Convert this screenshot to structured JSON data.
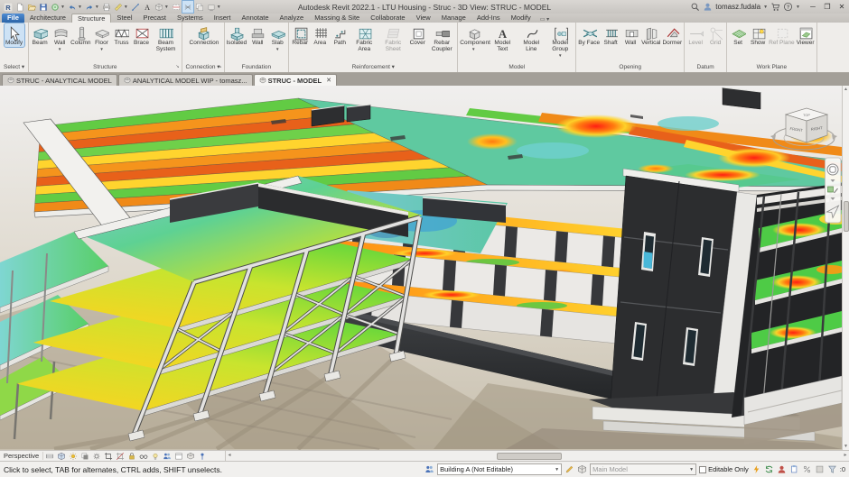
{
  "title_bar": {
    "title": "Autodesk Revit 2022.1 - LTU Housing - Struc - 3D View: STRUC - MODEL",
    "user_name": "tomasz.fudala",
    "qat": [
      {
        "name": "revit-logo"
      },
      {
        "name": "new-file"
      },
      {
        "name": "open-file"
      },
      {
        "name": "save"
      },
      {
        "name": "sync",
        "caret": true
      },
      {
        "name": "undo",
        "caret": true
      },
      {
        "name": "redo",
        "caret": true
      },
      {
        "name": "print"
      },
      {
        "name": "measure",
        "caret": true
      },
      {
        "name": "model-line"
      },
      {
        "name": "text"
      },
      {
        "name": "default-3d-view",
        "caret": true
      },
      {
        "name": "section"
      },
      {
        "name": "thin-lines",
        "active": true
      },
      {
        "name": "switch-windows"
      },
      {
        "name": "customize-qat",
        "caret": true
      }
    ],
    "right_icons": [
      "search",
      "user"
    ],
    "right_icons_after": [
      "cart",
      "help"
    ],
    "window_buttons": [
      "minimize",
      "restore",
      "close"
    ]
  },
  "ribbon": {
    "tabs": [
      {
        "label": "File",
        "file": true
      },
      {
        "label": "Architecture"
      },
      {
        "label": "Structure",
        "active": true
      },
      {
        "label": "Steel"
      },
      {
        "label": "Precast"
      },
      {
        "label": "Systems"
      },
      {
        "label": "Insert"
      },
      {
        "label": "Annotate"
      },
      {
        "label": "Analyze"
      },
      {
        "label": "Massing & Site"
      },
      {
        "label": "Collaborate"
      },
      {
        "label": "View"
      },
      {
        "label": "Manage"
      },
      {
        "label": "Add-Ins"
      },
      {
        "label": "Modify"
      }
    ],
    "panels": [
      {
        "label": "Select",
        "caret": true,
        "buttons": [
          {
            "label": "Modify",
            "icon": "modify",
            "selected": true
          }
        ]
      },
      {
        "label": "Structure",
        "dialog": true,
        "buttons": [
          {
            "label": "Beam",
            "icon": "beam"
          },
          {
            "label": "Wall",
            "icon": "wall",
            "dropdown": true
          },
          {
            "label": "Column",
            "icon": "column"
          },
          {
            "label": "Floor",
            "icon": "floor",
            "dropdown": true
          },
          {
            "label": "Truss",
            "icon": "truss"
          },
          {
            "label": "Brace",
            "icon": "brace"
          },
          {
            "label": "Beam System",
            "icon": "beam-system"
          }
        ]
      },
      {
        "label": "Connection",
        "caret": true,
        "dialog": true,
        "buttons": [
          {
            "label": "Connection",
            "icon": "connection"
          }
        ]
      },
      {
        "label": "Foundation",
        "buttons": [
          {
            "label": "Isolated",
            "icon": "isolated"
          },
          {
            "label": "Wall",
            "icon": "wall-foundation"
          },
          {
            "label": "Slab",
            "icon": "slab",
            "dropdown": true
          }
        ]
      },
      {
        "label": "Reinforcement",
        "caret": true,
        "buttons": [
          {
            "label": "Rebar",
            "icon": "rebar"
          },
          {
            "label": "Area",
            "icon": "area"
          },
          {
            "label": "Path",
            "icon": "path"
          },
          {
            "label": "Fabric Area",
            "icon": "fabric-area"
          },
          {
            "label": "Fabric Sheet",
            "icon": "fabric-sheet",
            "disabled": true
          },
          {
            "label": "Cover",
            "icon": "cover"
          },
          {
            "label": "Rebar Coupler",
            "icon": "rebar-coupler"
          }
        ]
      },
      {
        "label": "Model",
        "buttons": [
          {
            "label": "Component",
            "icon": "component",
            "dropdown": true
          },
          {
            "label": "Model Text",
            "icon": "model-text"
          },
          {
            "label": "Model Line",
            "icon": "model-line-r"
          },
          {
            "label": "Model Group",
            "icon": "model-group",
            "dropdown": true
          }
        ]
      },
      {
        "label": "Opening",
        "buttons": [
          {
            "label": "By Face",
            "icon": "by-face"
          },
          {
            "label": "Shaft",
            "icon": "shaft"
          },
          {
            "label": "Wall",
            "icon": "wall-opening"
          },
          {
            "label": "Vertical",
            "icon": "vertical"
          },
          {
            "label": "Dormer",
            "icon": "dormer"
          }
        ]
      },
      {
        "label": "Datum",
        "buttons": [
          {
            "label": "Level",
            "icon": "level",
            "disabled": true
          },
          {
            "label": "Grid",
            "icon": "grid",
            "disabled": true
          }
        ]
      },
      {
        "label": "Work Plane",
        "buttons": [
          {
            "label": "Set",
            "icon": "set"
          },
          {
            "label": "Show",
            "icon": "show"
          },
          {
            "label": "Ref Plane",
            "icon": "ref-plane",
            "disabled": true
          },
          {
            "label": "Viewer",
            "icon": "viewer"
          }
        ]
      }
    ]
  },
  "view_tabs": [
    {
      "label": "STRUC - ANALYTICAL MODEL"
    },
    {
      "label": "ANALYTICAL MODEL WIP - tomasz..."
    },
    {
      "label": "STRUC - MODEL",
      "active": true,
      "closable": true
    }
  ],
  "viewport": {
    "viewcube": {
      "top": "TOP",
      "front": "FRONT",
      "right": "RIGHT"
    },
    "navigation_bar": [
      "steering-wheel",
      "zoom",
      "pan"
    ]
  },
  "view_control_bar": {
    "scale_label": "Perspective",
    "icons": [
      "detail-level",
      "visual-style",
      "sun-path",
      "shadows",
      "render-dialog",
      "crop-view",
      "show-crop",
      "lock-view",
      "hide-isolate",
      "reveal-hidden",
      "worksharing-display",
      "temp-view-properties",
      "displaced-elements",
      "reveal-constraints"
    ]
  },
  "status_bar": {
    "hint": "Click to select, TAB for alternates, CTRL adds, SHIFT unselects.",
    "workset_selector": "Building A (Not Editable)",
    "design_option_selector": "Main Model",
    "editable_only_label": "Editable Only",
    "filter_count": ":0",
    "right_icon_cluster": [
      "bolt",
      "sync-mini",
      "person-red",
      "clip",
      "percent",
      "gear"
    ]
  }
}
